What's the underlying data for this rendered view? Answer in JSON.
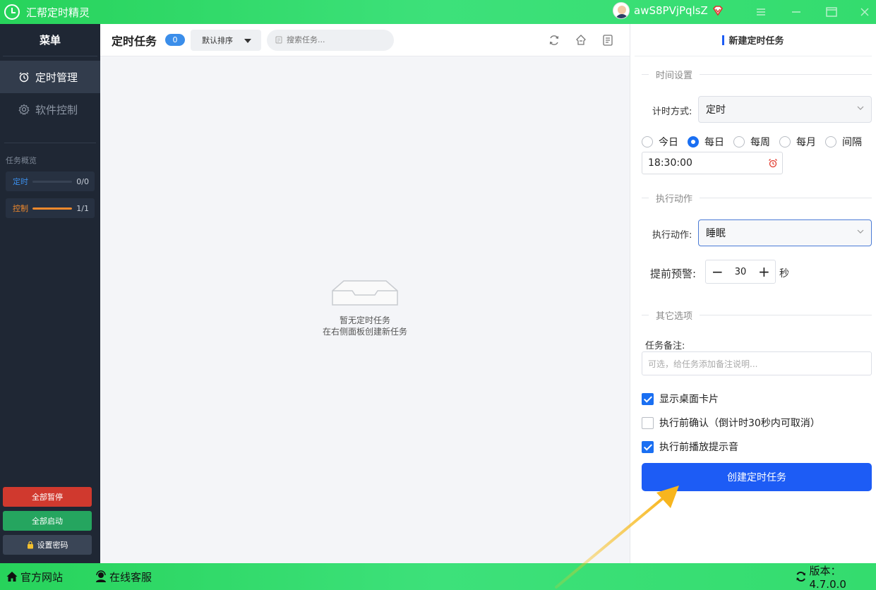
{
  "app": {
    "title": "汇帮定时精灵",
    "user_name": "awS8PVjPqlsZ"
  },
  "sidebar": {
    "header": "菜单",
    "nav": [
      {
        "label": "定时管理",
        "icon": "alarm-clock-icon",
        "active": true
      },
      {
        "label": "软件控制",
        "icon": "gear-icon",
        "active": false
      }
    ],
    "overview_title": "任务概览",
    "overview": [
      {
        "label": "定时",
        "count": "0/0",
        "progress": 0,
        "color": "#3b8eea"
      },
      {
        "label": "控制",
        "count": "1/1",
        "progress": 1,
        "color": "#f0892c"
      }
    ],
    "pause_all": "全部暂停",
    "start_all": "全部启动",
    "set_password": "设置密码"
  },
  "center": {
    "title": "定时任务",
    "count": "0",
    "sort_label": "默认排序",
    "search_placeholder": "搜索任务...",
    "empty_line1": "暂无定时任务",
    "empty_line2": "在右侧面板创建新任务"
  },
  "panel": {
    "title": "新建定时任务",
    "time_section": "时间设置",
    "timing_mode_label": "计时方式:",
    "timing_mode_value": "定时",
    "frequency_options": [
      {
        "label": "今日",
        "checked": false
      },
      {
        "label": "每日",
        "checked": true
      },
      {
        "label": "每周",
        "checked": false
      },
      {
        "label": "每月",
        "checked": false
      },
      {
        "label": "间隔",
        "checked": false
      }
    ],
    "time_value": "18:30:00",
    "action_section": "执行动作",
    "action_label": "执行动作:",
    "action_value": "睡眠",
    "warning_label": "提前预警:",
    "warning_value": "30",
    "warning_unit": "秒",
    "other_section": "其它选项",
    "note_label": "任务备注:",
    "note_placeholder": "可选，给任务添加备注说明...",
    "options": [
      {
        "label": "显示桌面卡片",
        "checked": true
      },
      {
        "label": "执行前确认（倒计时30秒内可取消）",
        "checked": false
      },
      {
        "label": "执行前播放提示音",
        "checked": true
      }
    ],
    "create_button": "创建定时任务"
  },
  "statusbar": {
    "website": "官方网站",
    "support": "在线客服",
    "version": "版本：4.7.0.0"
  },
  "colors": {
    "accent": "#1d5cf5",
    "titlebar_green": "#3de17a",
    "sidebar_bg": "#1f2734",
    "pause_red": "#d0392e",
    "start_green": "#25a55f"
  }
}
